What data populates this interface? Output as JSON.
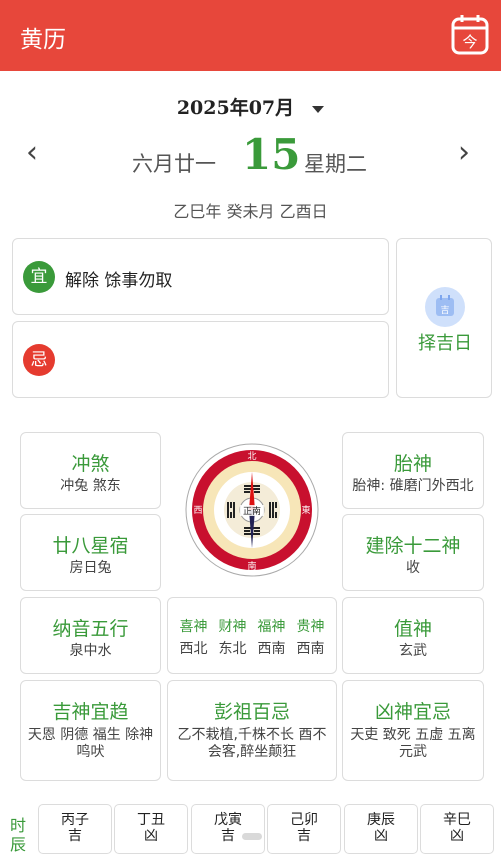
{
  "header": {
    "title": "黄历",
    "today_icon": "calendar-today-icon",
    "today_glyph": "今",
    "accent": "#e7473b"
  },
  "date": {
    "year_month": "2025年07月",
    "lunar": "六月廿一",
    "day": "15",
    "weekday": "星期二",
    "ganzhi": "乙巳年 癸未月 乙酉日"
  },
  "yi": {
    "badge": "宜",
    "text": "解除 馀事勿取"
  },
  "ji": {
    "badge": "忌",
    "text": ""
  },
  "zeji": {
    "label": "择吉日",
    "icon_glyph": "吉"
  },
  "boxes": {
    "chongsha": {
      "title": "冲煞",
      "value": "冲兔 煞东"
    },
    "taishen": {
      "title": "胎神",
      "value": "胎神: 碓磨门外西北"
    },
    "xingxiu": {
      "title": "廿八星宿",
      "value": "房日兔"
    },
    "jianchu": {
      "title": "建除十二神",
      "value": "收"
    },
    "nayin": {
      "title": "纳音五行",
      "value": "泉中水"
    },
    "zhishen": {
      "title": "值神",
      "value": "玄武"
    },
    "jishen": {
      "title": "吉神宜趋",
      "value": "天恩 阴德 福生 除神 鸣吠"
    },
    "pengzu": {
      "title": "彭祖百忌",
      "value": "乙不栽植,千株不长 酉不会客,醉坐颠狂"
    },
    "xiongshen": {
      "title": "凶神宜忌",
      "value": "天吏 致死 五虚 五离 元武"
    }
  },
  "gods": [
    {
      "name": "喜神",
      "dir": "西北"
    },
    {
      "name": "财神",
      "dir": "东北"
    },
    {
      "name": "福神",
      "dir": "西南"
    },
    {
      "name": "贵神",
      "dir": "西南"
    }
  ],
  "compass": {
    "north": "北",
    "south": "南",
    "east": "東",
    "west": "西",
    "center": "正南"
  },
  "shichen": {
    "label": "时辰",
    "hours": [
      {
        "name": "丙子",
        "luck": "吉"
      },
      {
        "name": "丁丑",
        "luck": "凶"
      },
      {
        "name": "戊寅",
        "luck": "吉"
      },
      {
        "name": "己卯",
        "luck": "吉"
      },
      {
        "name": "庚辰",
        "luck": "凶"
      },
      {
        "name": "辛巳",
        "luck": "凶"
      }
    ]
  }
}
